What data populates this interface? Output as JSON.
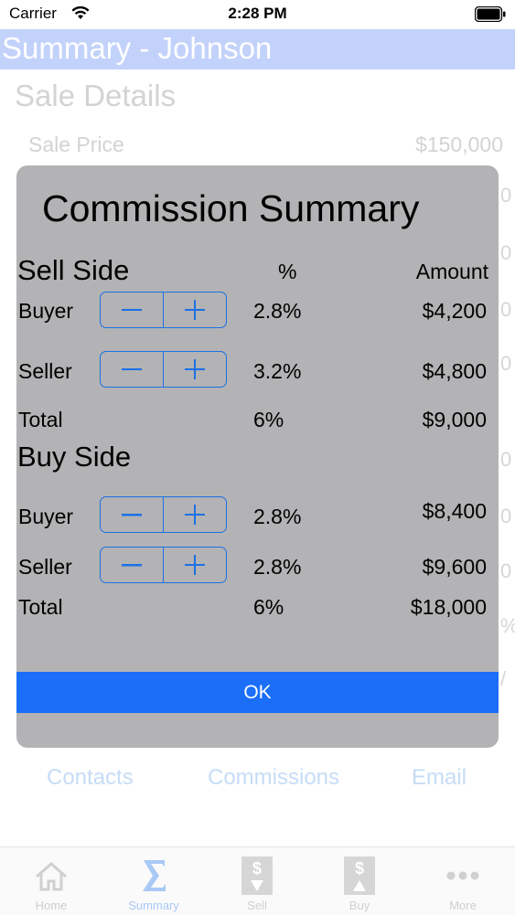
{
  "status_bar": {
    "carrier": "Carrier",
    "time": "2:28 PM"
  },
  "nav": {
    "title": "Summary - Johnson"
  },
  "background": {
    "section_title": "Sale Details",
    "sale_price_label": "Sale Price",
    "sale_price_value": "$150,000",
    "links": {
      "contacts": "Contacts",
      "commissions": "Commissions",
      "email": "Email"
    }
  },
  "dialog": {
    "title": "Commission Summary",
    "sell_side": {
      "heading": "Sell Side",
      "percent_header": "%",
      "amount_header": "Amount",
      "rows": [
        {
          "label": "Buyer",
          "percent": "2.8%",
          "amount": "$4,200"
        },
        {
          "label": "Seller",
          "percent": "3.2%",
          "amount": "$4,800"
        }
      ],
      "total_label": "Total",
      "total_percent": "6%",
      "total_amount": "$9,000"
    },
    "buy_side": {
      "heading": "Buy Side",
      "rows": [
        {
          "label": "Buyer",
          "percent": "2.8%",
          "amount": "$8,400"
        },
        {
          "label": "Seller",
          "percent": "2.8%",
          "amount": "$9,600"
        }
      ],
      "total_label": "Total",
      "total_percent": "6%",
      "total_amount": "$18,000"
    },
    "ok_label": "OK"
  },
  "tabs": [
    {
      "label": "Home",
      "icon": "home-icon"
    },
    {
      "label": "Summary",
      "icon": "sigma-icon"
    },
    {
      "label": "Sell",
      "icon": "dollar-down-icon"
    },
    {
      "label": "Buy",
      "icon": "dollar-up-icon"
    },
    {
      "label": "More",
      "icon": "more-icon"
    }
  ],
  "colors": {
    "accent": "#1a6ef8",
    "nav_bar": "#c3d2fb",
    "dialog_bg": "#b3b2b4",
    "stepper_tint": "#1b71e6"
  }
}
